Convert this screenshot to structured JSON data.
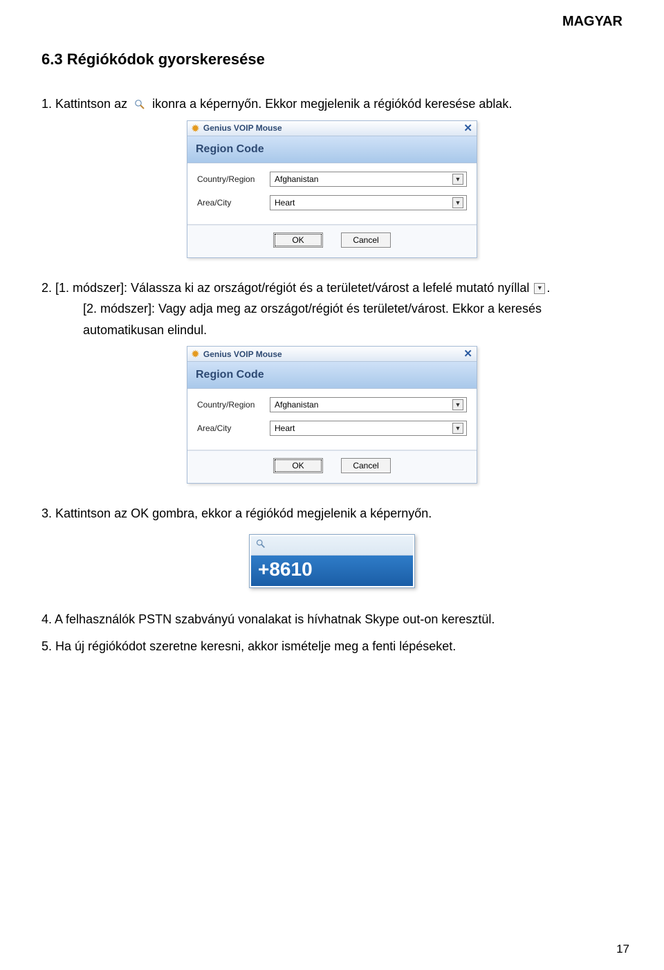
{
  "header": {
    "lang": "MAGYAR"
  },
  "section": {
    "title": "6.3 Régiókódok gyorskeresése"
  },
  "para": {
    "p1a": "1.  Kattintson az",
    "p1b": "ikonra a képernyőn. Ekkor megjelenik a régiókód keresése ablak.",
    "p2a": "2.  [1. módszer]: Válassza ki az országot/régiót és a területet/várost a lefelé mutató nyíllal",
    "p2b": ".",
    "p2c": "[2. módszer]: Vagy adja meg az országot/régiót és területet/várost. Ekkor a keresés",
    "p2d": "automatikusan elindul.",
    "p3": "3.  Kattintson az OK gombra, ekkor a régiókód megjelenik a képernyőn.",
    "p4": "4.  A felhasználók PSTN szabványú vonalakat is hívhatnak Skype out-on keresztül.",
    "p5": "5.  Ha új régiókódot szeretne keresni, akkor ismételje meg a fenti lépéseket."
  },
  "dialog": {
    "title": "Genius VOIP Mouse",
    "header": "Region Code",
    "countryLabel": "Country/Region",
    "countryValue": "Afghanistan",
    "areaLabel": "Area/City",
    "areaValue": "Heart",
    "ok": "OK",
    "cancel": "Cancel"
  },
  "result": {
    "value": "+8610"
  },
  "page": {
    "num": "17"
  }
}
